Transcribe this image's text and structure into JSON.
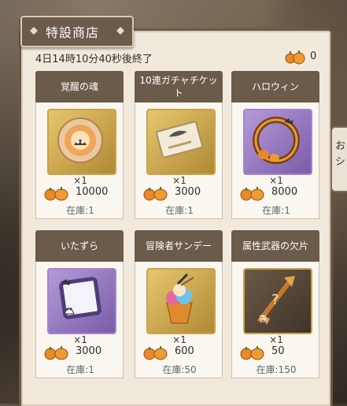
{
  "shop": {
    "title": "特設商店",
    "timer": "4日14時10分40秒後終了",
    "currency_count": "0",
    "side_tab_text": "おシ"
  },
  "items": [
    {
      "name": "覚醒の魂",
      "quantity": "×1",
      "price": "10000",
      "stock": "在庫:1",
      "frame": "gold",
      "icon": "awakening-soul-icon"
    },
    {
      "name": "10連ガチャチケット",
      "quantity": "×1",
      "price": "3000",
      "stock": "在庫:1",
      "frame": "gold",
      "icon": "gacha-ticket-icon"
    },
    {
      "name": "ハロウィン",
      "quantity": "×1",
      "price": "8000",
      "stock": "在庫:1",
      "frame": "purple",
      "icon": "halloween-frame-icon"
    },
    {
      "name": "いたずら",
      "quantity": "×1",
      "price": "3000",
      "stock": "在庫:1",
      "frame": "purple",
      "icon": "prank-frame-icon"
    },
    {
      "name": "冒険者サンデー",
      "quantity": "×1",
      "price": "600",
      "stock": "在庫:50",
      "frame": "gold",
      "icon": "sundae-icon"
    },
    {
      "name": "属性武器の欠片",
      "quantity": "×1",
      "price": "50",
      "stock": "在庫:150",
      "frame": "gold",
      "icon": "weapon-fragment-icon"
    }
  ],
  "colors": {
    "header_brown": "#6b5b4a",
    "panel_bg": "#f1eadc",
    "gold_frame": "#c9a24b",
    "purple_frame": "#a385cf",
    "pumpkin": "#e8892a"
  }
}
